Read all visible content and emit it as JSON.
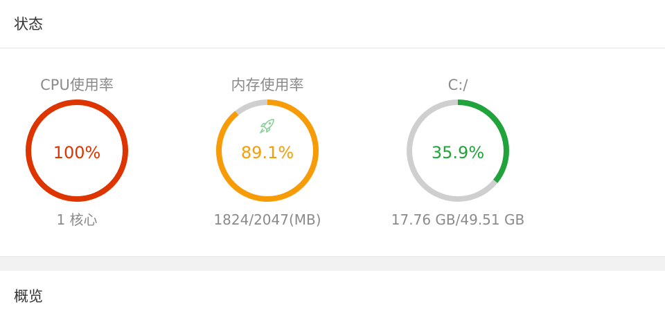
{
  "status_card": {
    "title": "状态"
  },
  "overview_card": {
    "title": "概览"
  },
  "gauges": [
    {
      "label": "CPU使用率",
      "value_text": "100%",
      "percent": 100,
      "sub": "1 核心",
      "color": "#dd3400"
    },
    {
      "label": "内存使用率",
      "value_text": "89.1%",
      "percent": 89.1,
      "sub": "1824/2047(MB)",
      "color": "#f79c07",
      "icon": "rocket-icon"
    },
    {
      "label": "C:/",
      "value_text": "35.9%",
      "percent": 35.9,
      "sub": "17.76 GB/49.51 GB",
      "color": "#1fa33a"
    }
  ],
  "colors": {
    "track": "#cfcfcf",
    "rocket": "#8fd29e"
  }
}
